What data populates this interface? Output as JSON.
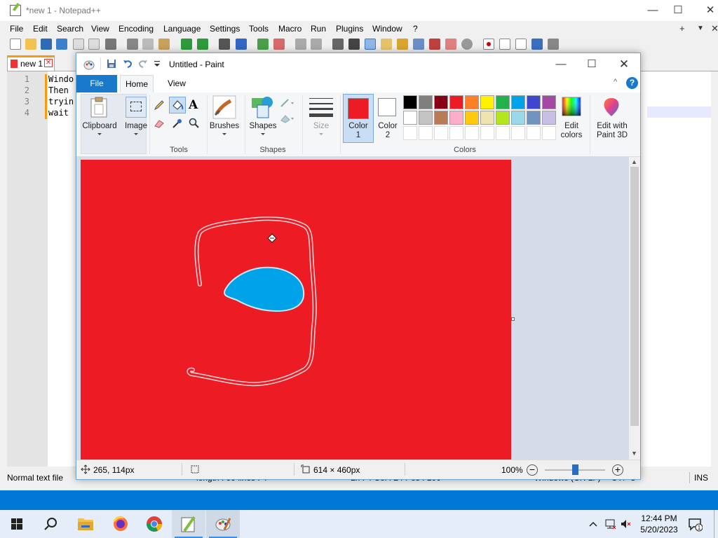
{
  "npp": {
    "title": "*new 1 - Notepad++",
    "menu": [
      "File",
      "Edit",
      "Search",
      "View",
      "Encoding",
      "Language",
      "Settings",
      "Tools",
      "Macro",
      "Run",
      "Plugins",
      "Window",
      "?"
    ],
    "menu_right": [
      "+",
      "▼",
      "✕"
    ],
    "tab": {
      "label": "new 1"
    },
    "lines": [
      {
        "num": "1",
        "text": "Windo"
      },
      {
        "num": "2",
        "text": "Then"
      },
      {
        "num": "3",
        "text": "tryin"
      },
      {
        "num": "4",
        "text": "wait"
      }
    ],
    "status": {
      "filetype": "Normal text file",
      "length": "length : 99    lines : 4",
      "position": "Ln : 4    Col : 24    Pos : 100",
      "eol": "Windows (CR LF)",
      "encoding": "UTF-8",
      "mode": "INS"
    }
  },
  "paint": {
    "title": "Untitled - Paint",
    "tabs": {
      "file": "File",
      "home": "Home",
      "view": "View"
    },
    "help": "?",
    "ribbon": {
      "clipboard": "Clipboard",
      "image": "Image",
      "tools_group": "Tools",
      "brushes": "Brushes",
      "shapes": "Shapes",
      "shapes_group": "Shapes",
      "size": "Size",
      "color1_line1": "Color",
      "color1_line2": "1",
      "color2_line1": "Color",
      "color2_line2": "2",
      "colors_group": "Colors",
      "edit_colors_line1": "Edit",
      "edit_colors_line2": "colors",
      "edit_paint3d_line1": "Edit with",
      "edit_paint3d_line2": "Paint 3D",
      "text_tool_glyph": "A"
    },
    "color1": "#ed1c24",
    "color2": "#ffffff",
    "palette_row1": [
      "#000000",
      "#7f7f7f",
      "#880015",
      "#ed1c24",
      "#ff7f27",
      "#fff200",
      "#22b14c",
      "#00a2e8",
      "#3f48cc",
      "#a349a4"
    ],
    "palette_row2": [
      "#ffffff",
      "#c3c3c3",
      "#b97a57",
      "#ffaec9",
      "#ffc90e",
      "#efe4b0",
      "#b5e61d",
      "#99d9ea",
      "#7092be",
      "#c8bfe7"
    ],
    "canvas_fill": "#ed1c24",
    "blob_fill": "#00a2e8",
    "status": {
      "cursor_pos": "265, 114px",
      "image_size": "614 × 460px",
      "zoom": "100%"
    },
    "zoom_level_fraction": 0.5
  },
  "taskbar": {
    "time": "12:44 PM",
    "date": "5/20/2023"
  }
}
